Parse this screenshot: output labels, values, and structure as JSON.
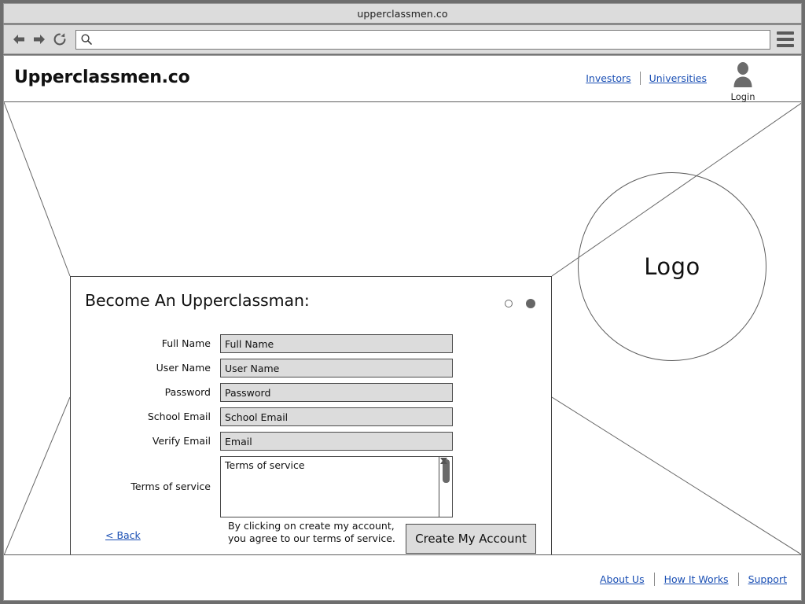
{
  "browser": {
    "title": "upperclassmen.co",
    "url_value": "",
    "url_placeholder": "",
    "back_icon": "back-arrow-icon",
    "forward_icon": "forward-arrow-icon",
    "reload_icon": "reload-icon",
    "search_icon": "search-icon",
    "menu_icon": "hamburger-menu-icon"
  },
  "header": {
    "brand": "Upperclassmen.co",
    "nav": [
      {
        "label": "Investors"
      },
      {
        "label": "Universities"
      }
    ],
    "login_label": "Login",
    "login_icon": "user-avatar-icon"
  },
  "hero": {
    "logo_label": "Logo"
  },
  "panel": {
    "title": "Become An Upperclassman:",
    "step_dots": [
      {
        "state": "inactive"
      },
      {
        "state": "active"
      }
    ],
    "fields": [
      {
        "label": "Full Name",
        "value": "Full Name",
        "placeholder": "Full Name",
        "type": "text"
      },
      {
        "label": "User Name",
        "value": "User Name",
        "placeholder": "User Name",
        "type": "text"
      },
      {
        "label": "Password",
        "value": "Password",
        "placeholder": "Password",
        "type": "text"
      },
      {
        "label": "School Email",
        "value": "School Email",
        "placeholder": "School Email",
        "type": "text"
      },
      {
        "label": "Verify Email",
        "value": "Email",
        "placeholder": "Email",
        "type": "text"
      }
    ],
    "terms": {
      "label": "Terms of service",
      "body": "Terms of service",
      "scroll_up_icon": "scroll-up-arrow-icon",
      "scroll_down_icon": "scroll-down-arrow-icon"
    },
    "back_label": "< Back",
    "consent_note": "By clicking on create my account, you agree to our terms of service.",
    "submit_label": "Create My Account"
  },
  "footer": {
    "nav": [
      {
        "label": "About Us"
      },
      {
        "label": "How It Works"
      },
      {
        "label": "Support"
      }
    ]
  },
  "colors": {
    "link": "#1a4fb4",
    "chrome": "#dcdcdc",
    "field": "#dcdcdc",
    "outline": "#4a4a4a",
    "desktop": "#6e6e6e"
  }
}
